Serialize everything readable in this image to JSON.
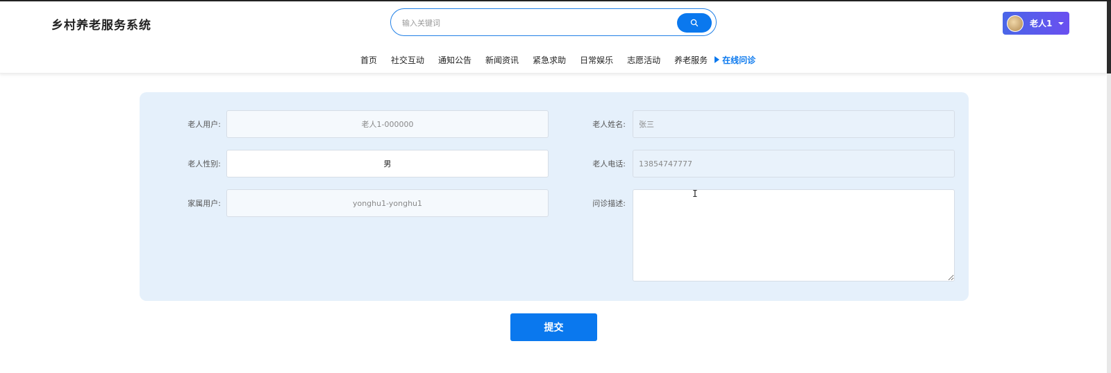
{
  "header": {
    "site_title": "乡村养老服务系统",
    "search": {
      "placeholder": "输入关键词",
      "button_icon": "search-icon"
    },
    "user": {
      "name": "老人1",
      "avatar_icon": "avatar-icon",
      "menu_icon": "caret-down-icon"
    }
  },
  "nav": {
    "items": [
      {
        "label": "首页"
      },
      {
        "label": "社交互动"
      },
      {
        "label": "通知公告"
      },
      {
        "label": "新闻资讯"
      },
      {
        "label": "紧急求助"
      },
      {
        "label": "日常娱乐"
      },
      {
        "label": "志愿活动"
      },
      {
        "label": "养老服务"
      }
    ],
    "active": {
      "label": "在线问诊",
      "icon": "triangle-right-icon"
    }
  },
  "form": {
    "elder_user": {
      "label": "老人用户:",
      "value": "老人1-000000"
    },
    "elder_name": {
      "label": "老人姓名:",
      "value": "张三"
    },
    "elder_gender": {
      "label": "老人性别:",
      "value": "男"
    },
    "elder_phone": {
      "label": "老人电话:",
      "value": "13854747777"
    },
    "family_user": {
      "label": "家属用户:",
      "value": "yonghu1-yonghu1"
    },
    "consult_desc": {
      "label": "问诊描述:",
      "value": ""
    }
  },
  "actions": {
    "submit_label": "提交"
  },
  "colors": {
    "accent": "#0a78ee",
    "panel_bg": "#e5f0fb",
    "user_btn": "#5a5cec"
  }
}
